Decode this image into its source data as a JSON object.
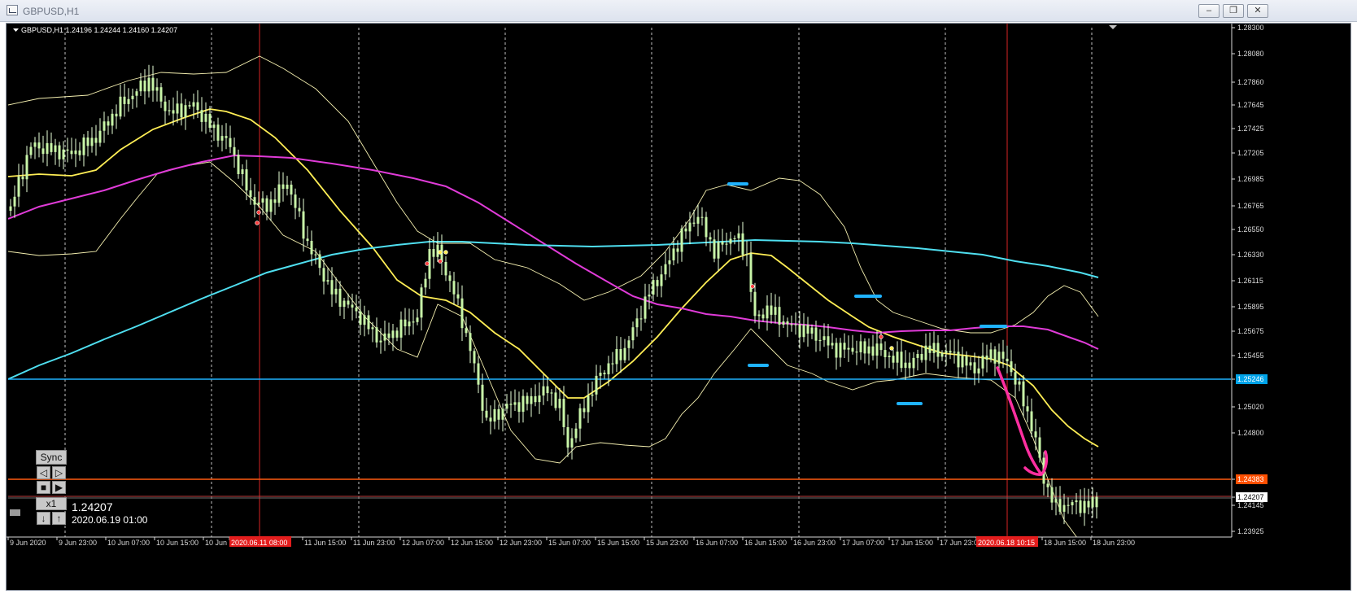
{
  "window": {
    "title": "GBPUSD,H1",
    "buttons": [
      "minimize",
      "restore",
      "close"
    ]
  },
  "chart": {
    "info_label": "GBPUSD,H1  1.24196 1.24244 1.24160 1.24207",
    "price_axis": [
      "1.28300",
      "1.28080",
      "1.27860",
      "1.27645",
      "1.27425",
      "1.27205",
      "1.26985",
      "1.26765",
      "1.26550",
      "1.26330",
      "1.26115",
      "1.25895",
      "1.25675",
      "1.25455",
      "1.25246",
      "1.25020",
      "1.24800",
      "1.24383",
      "1.24207",
      "1.24145",
      "1.23925"
    ],
    "price_markers": [
      {
        "label": "1.25246",
        "color": "#00a3e8"
      },
      {
        "label": "1.24383",
        "color": "#ff4f00"
      },
      {
        "label": "1.24207",
        "color": "#ffffff"
      }
    ],
    "time_axis": [
      "9 Jun 2020",
      "9 Jun 23:00",
      "10 Jun 07:00",
      "10 Jun 15:00",
      "10 Jun 2",
      "2020.06.11 08:00",
      "11 Jun 15:00",
      "11 Jun 23:00",
      "12 Jun 07:00",
      "12 Jun 15:00",
      "12 Jun 23:00",
      "15 Jun 07:00",
      "15 Jun 15:00",
      "15 Jun 23:00",
      "16 Jun 07:00",
      "16 Jun 15:00",
      "16 Jun 23:00",
      "17 Jun 07:00",
      "17 Jun 15:00",
      "17 Jun 23:00",
      "2020.06.18 10:15",
      "18 Jun 15:00",
      "18 Jun 23:00"
    ],
    "time_highlights": [
      "2020.06.11 08:00",
      "2020.06.18 10:15"
    ],
    "colors": {
      "background": "#000000",
      "candle_body": "#c8f5a8",
      "wick": "#e8ffd8",
      "bollinger": "#f5f0b0",
      "ma_yellow": "#ffee55",
      "ma_magenta": "#e03bd8",
      "ma_cyan": "#4fdff0",
      "support_line": "#1fb3ff",
      "resistance_line": "#ff5a10",
      "current_price_line": "#c14040",
      "annotation": "#ff2fa0",
      "grid": "#d8d8d8"
    }
  },
  "player": {
    "sync": "Sync",
    "prev_icon": "◁",
    "next_icon": "▷",
    "stop_icon": "■",
    "play_icon": "▶",
    "speed": "x1",
    "down_icon": "↓",
    "up_icon": "↑",
    "price": "1.24207",
    "datetime": "2020.06.19 01:00"
  }
}
